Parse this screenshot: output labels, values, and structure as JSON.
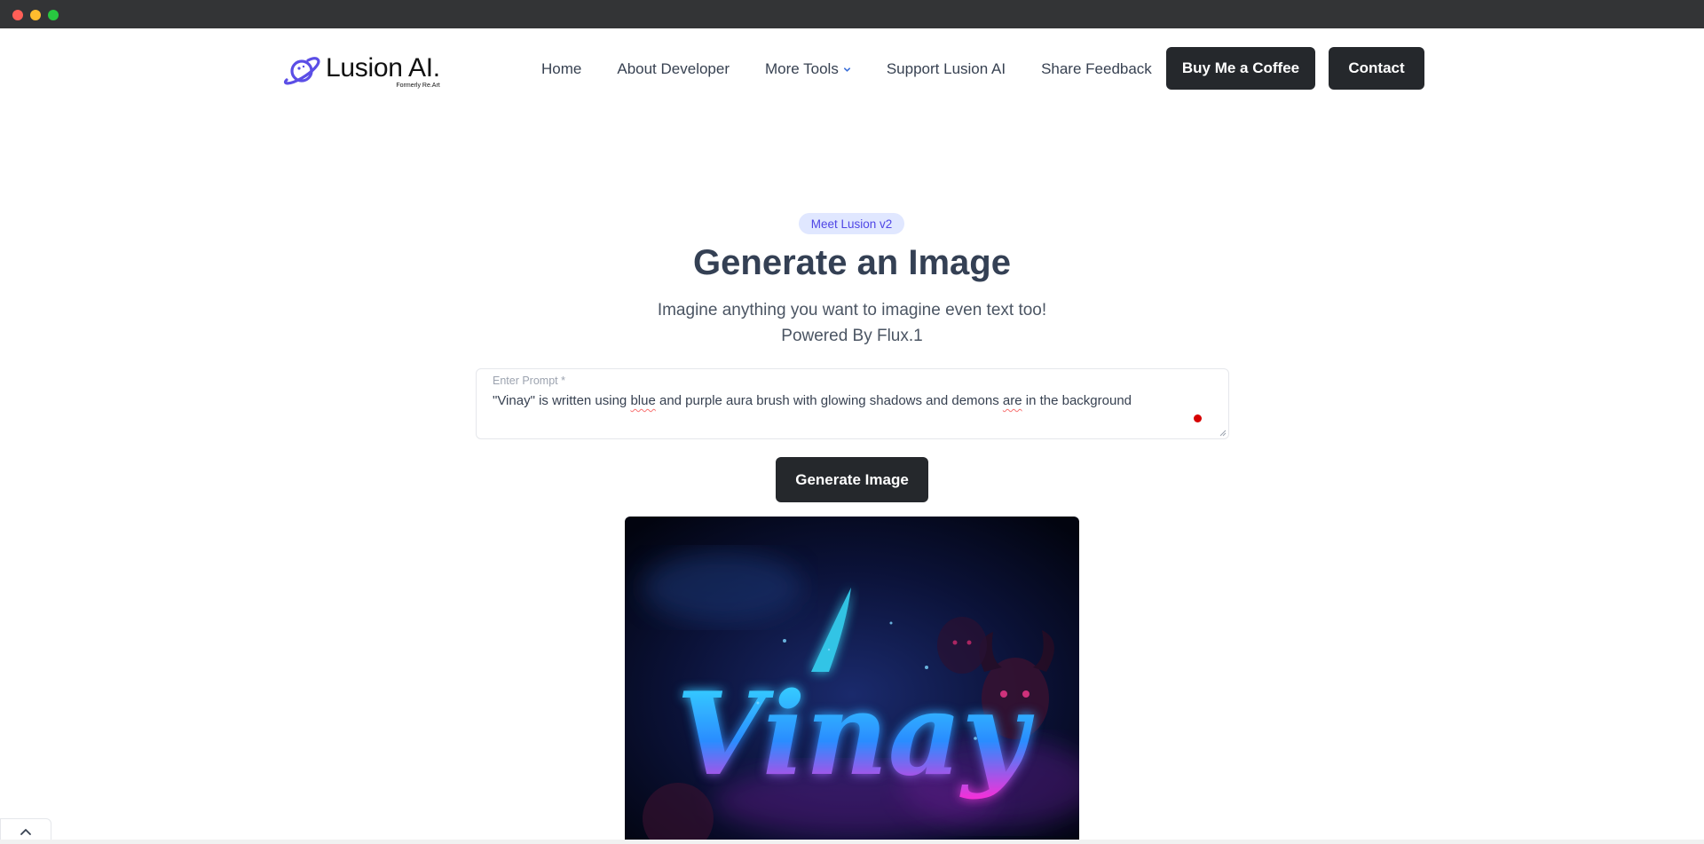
{
  "window": {
    "controls": [
      "close",
      "minimize",
      "maximize"
    ]
  },
  "header": {
    "logo_text": "Lusion AI.",
    "logo_subtext": "Formerly Re.Art",
    "nav": [
      {
        "label": "Home"
      },
      {
        "label": "About Developer"
      },
      {
        "label": "More Tools",
        "has_dropdown": true
      },
      {
        "label": "Support Lusion AI"
      },
      {
        "label": "Share Feedback"
      }
    ],
    "buy_coffee_label": "Buy Me a Coffee",
    "contact_label": "Contact"
  },
  "hero": {
    "badge": "Meet Lusion v2",
    "title": "Generate an Image",
    "subtitle_line1": "Imagine anything you want to imagine even text too!",
    "subtitle_line2": "Powered By Flux.1"
  },
  "prompt": {
    "label": "Enter Prompt *",
    "value_parts": [
      "\"Vinay\" is written using ",
      "blue",
      " and purple aura brush with glowing shadows and demons ",
      "are",
      " in the background"
    ]
  },
  "generate_button_label": "Generate Image",
  "result_image": {
    "text": "Vinay"
  },
  "colors": {
    "primary_dark": "#25282c",
    "accent": "#4f46e5",
    "badge_bg": "#e0e7ff",
    "heading": "#344054"
  },
  "icons": [
    "planet-logo-icon",
    "chevron-down-icon",
    "chevron-up-icon"
  ]
}
